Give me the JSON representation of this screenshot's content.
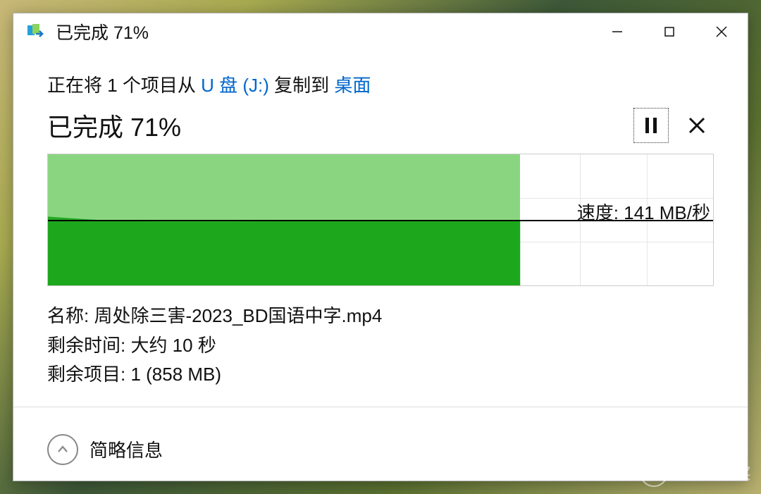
{
  "titlebar": {
    "title": "已完成 71%"
  },
  "body": {
    "copy_prefix": "正在将 1 个项目从 ",
    "source_link": "U 盘 (J:) ",
    "copy_mid": "复制到 ",
    "dest_link": "桌面",
    "status": "已完成 71%"
  },
  "speed": {
    "label": "速度: ",
    "value": "141 MB/秒"
  },
  "details": {
    "name_label": "名称: ",
    "name_value": "周处除三害-2023_BD国语中字.mp4",
    "time_label": "剩余时间: ",
    "time_value": "大约 10 秒",
    "items_label": "剩余项目: ",
    "items_value": "1 (858 MB)"
  },
  "footer": {
    "toggle": "简略信息"
  },
  "watermark": {
    "badge": "值",
    "text": "什么值得买"
  },
  "chart_data": {
    "type": "area",
    "title": "",
    "xlabel": "",
    "ylabel": "",
    "progress_percent": 71,
    "speed_mb_s": 141,
    "ylim": [
      0,
      282
    ],
    "grid_cols": 10,
    "grid_rows": 3,
    "x": [
      0,
      5,
      10,
      15,
      20,
      25,
      30,
      35,
      40,
      45,
      50,
      55,
      60,
      65,
      70,
      71
    ],
    "values": [
      148,
      143,
      139,
      137,
      136,
      136,
      137,
      138,
      138,
      140,
      140,
      141,
      140,
      140,
      141,
      141
    ]
  }
}
